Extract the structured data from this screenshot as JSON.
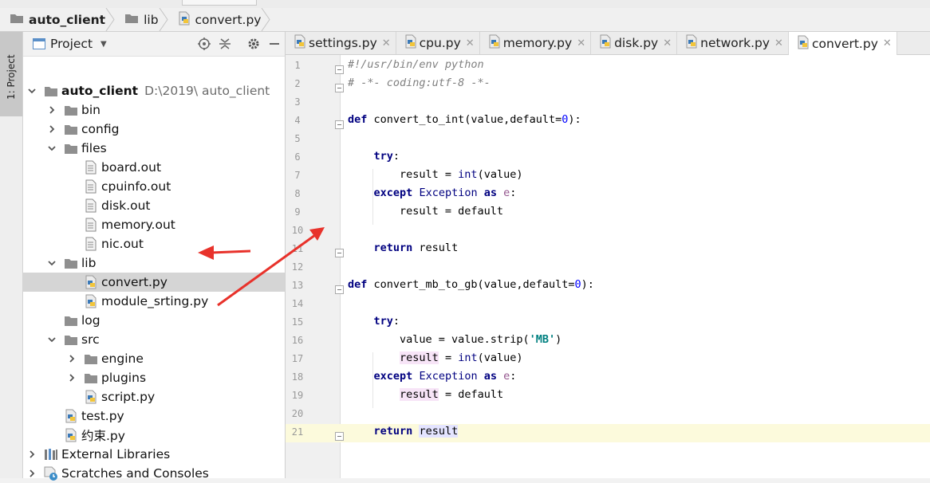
{
  "breadcrumbs": [
    {
      "label": "auto_client",
      "icon": "folder-icon",
      "bold": true
    },
    {
      "label": "lib",
      "icon": "folder-icon",
      "bold": false
    },
    {
      "label": "convert.py",
      "icon": "python-file-icon",
      "bold": false
    }
  ],
  "tool_stripe": {
    "label": "1: Project"
  },
  "project_panel": {
    "title": "Project",
    "tools": [
      "locate-icon",
      "collapse-icon",
      "gear-icon",
      "minimize-icon"
    ],
    "tree": [
      {
        "label": "auto_client",
        "path": "D:\\2019\\ auto_client",
        "depth": 0,
        "arrow": "down",
        "icon": "folder",
        "bold": true
      },
      {
        "label": "bin",
        "depth": 1,
        "arrow": "right",
        "icon": "folder"
      },
      {
        "label": "config",
        "depth": 1,
        "arrow": "right",
        "icon": "folder"
      },
      {
        "label": "files",
        "depth": 1,
        "arrow": "down",
        "icon": "folder"
      },
      {
        "label": "board.out",
        "depth": 2,
        "arrow": "",
        "icon": "file"
      },
      {
        "label": "cpuinfo.out",
        "depth": 2,
        "arrow": "",
        "icon": "file"
      },
      {
        "label": "disk.out",
        "depth": 2,
        "arrow": "",
        "icon": "file"
      },
      {
        "label": "memory.out",
        "depth": 2,
        "arrow": "",
        "icon": "file"
      },
      {
        "label": "nic.out",
        "depth": 2,
        "arrow": "",
        "icon": "file"
      },
      {
        "label": "lib",
        "depth": 1,
        "arrow": "down",
        "icon": "folder"
      },
      {
        "label": "convert.py",
        "depth": 2,
        "arrow": "",
        "icon": "python",
        "selected": true
      },
      {
        "label": "module_srting.py",
        "depth": 2,
        "arrow": "",
        "icon": "python"
      },
      {
        "label": "log",
        "depth": 1,
        "arrow": "",
        "icon": "folder"
      },
      {
        "label": "src",
        "depth": 1,
        "arrow": "down",
        "icon": "folder"
      },
      {
        "label": "engine",
        "depth": 2,
        "arrow": "right",
        "icon": "folder"
      },
      {
        "label": "plugins",
        "depth": 2,
        "arrow": "right",
        "icon": "folder"
      },
      {
        "label": "script.py",
        "depth": 2,
        "arrow": "",
        "icon": "python"
      },
      {
        "label": "test.py",
        "depth": 1,
        "arrow": "",
        "icon": "python"
      },
      {
        "label": "约束.py",
        "depth": 1,
        "arrow": "",
        "icon": "python"
      },
      {
        "label": "External Libraries",
        "depth": 0,
        "arrow": "right",
        "icon": "library"
      },
      {
        "label": "Scratches and Consoles",
        "depth": 0,
        "arrow": "right",
        "icon": "scratch"
      }
    ]
  },
  "tabs": [
    {
      "label": "settings.py",
      "active": false
    },
    {
      "label": "cpu.py",
      "active": false
    },
    {
      "label": "memory.py",
      "active": false
    },
    {
      "label": "disk.py",
      "active": false
    },
    {
      "label": "network.py",
      "active": false
    },
    {
      "label": "convert.py",
      "active": true
    }
  ],
  "code_lines": [
    {
      "n": "1",
      "text": "#!/usr/bin/env python"
    },
    {
      "n": "2",
      "text": "# -*- coding:utf-8 -*-"
    },
    {
      "n": "3",
      "text": ""
    },
    {
      "n": "4",
      "text": "def convert_to_int(value,default=0):"
    },
    {
      "n": "5",
      "text": ""
    },
    {
      "n": "6",
      "text": "    try:"
    },
    {
      "n": "7",
      "text": "        result = int(value)"
    },
    {
      "n": "8",
      "text": "    except Exception as e:"
    },
    {
      "n": "9",
      "text": "        result = default"
    },
    {
      "n": "10",
      "text": ""
    },
    {
      "n": "11",
      "text": "    return result"
    },
    {
      "n": "12",
      "text": ""
    },
    {
      "n": "13",
      "text": "def convert_mb_to_gb(value,default=0):"
    },
    {
      "n": "14",
      "text": ""
    },
    {
      "n": "15",
      "text": "    try:"
    },
    {
      "n": "16",
      "text": "        value = value.strip('MB')"
    },
    {
      "n": "17",
      "text": "        result = int(value)"
    },
    {
      "n": "18",
      "text": "    except Exception as e:"
    },
    {
      "n": "19",
      "text": "        result = default"
    },
    {
      "n": "20",
      "text": ""
    },
    {
      "n": "21",
      "text": "    return result"
    }
  ],
  "annotation": {
    "color": "#e8322b"
  },
  "colors": {
    "keyword": "#000080",
    "comment": "#808080",
    "number": "#0000ff",
    "string": "#008080",
    "current_line": "#fcfadc"
  }
}
